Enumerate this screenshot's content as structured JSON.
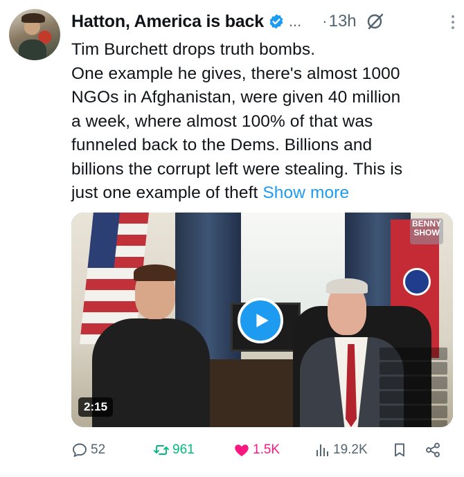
{
  "post": {
    "author_name": "Hatton, America is back",
    "handle_truncated": "...",
    "dot": "·",
    "time": "13h",
    "text_lines": [
      "Tim Burchett drops truth bombs.",
      "One example he gives, there's almost 1000",
      "NGOs  in Afghanistan,  were given 40 million",
      "a week, where almost 100% of that was",
      "funneled back to the Dems. Billions and",
      "billions the corrupt left were stealing. This is",
      "just one example of theft "
    ],
    "show_more": "Show more"
  },
  "media": {
    "logo_text": "BENNY SHOW",
    "duration": "2:15"
  },
  "actions": {
    "replies": "52",
    "reposts": "961",
    "likes": "1.5K",
    "views": "19.2K"
  },
  "colors": {
    "accent": "#1d9bf0",
    "repost": "#00ba7c",
    "like": "#f91880",
    "muted": "#536471"
  }
}
